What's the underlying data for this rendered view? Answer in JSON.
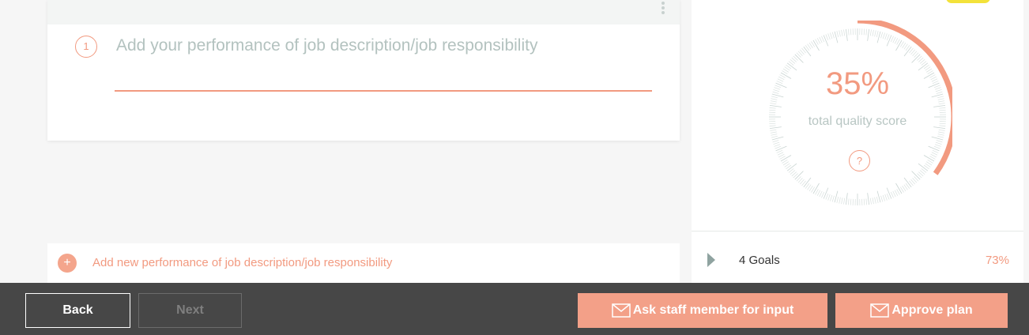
{
  "responsibility": {
    "number": "1",
    "placeholder": "Add your performance of job description/job responsibility",
    "value": ""
  },
  "add_new": {
    "plus_symbol": "+",
    "label": "Add new performance of job description/job responsibility"
  },
  "score_panel": {
    "value_text": "35%",
    "progress_fraction": 0.35,
    "label": "total quality score",
    "help_symbol": "?",
    "goals_label": "4 Goals",
    "goals_pct": "73%"
  },
  "footer": {
    "back_label": "Back",
    "next_label": "Next",
    "ask_label": "Ask staff member for input",
    "approve_label": "Approve plan"
  },
  "colors": {
    "accent": "#f29a80",
    "button_accent": "#f3a088",
    "footer_bg": "#474747",
    "badge": "#f3e23a"
  }
}
